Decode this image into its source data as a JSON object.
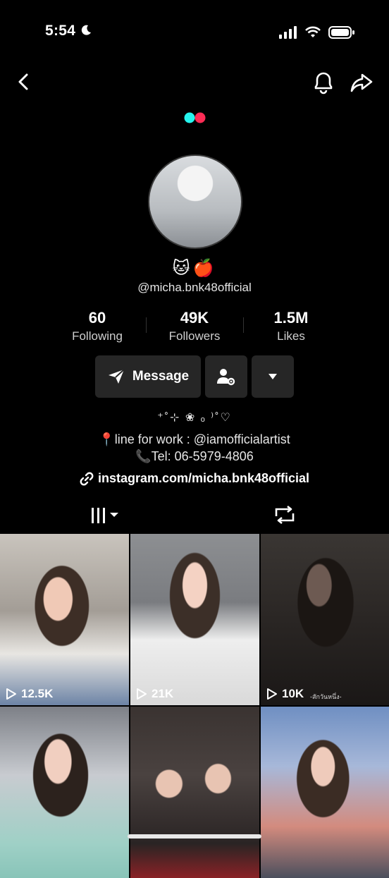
{
  "status_bar": {
    "time": "5:54",
    "moon_icon": "moon-icon",
    "signal_icon": "signal-icon",
    "wifi_icon": "wifi-icon",
    "battery_icon": "battery-icon"
  },
  "nav": {
    "back_icon": "chevron-left-icon",
    "bell_icon": "bell-icon",
    "share_icon": "share-icon"
  },
  "profile": {
    "emojis": "🐱🍎",
    "username": "@micha.bnk48official",
    "stats": [
      {
        "value": "60",
        "label": "Following"
      },
      {
        "value": "49K",
        "label": "Followers"
      },
      {
        "value": "1.5M",
        "label": "Likes"
      }
    ],
    "message_label": "Message",
    "bio_line1": "⁺˚⊹ ❀   ₒ ⁾˚♡",
    "bio_line2": "📍line for work : @iamofficialartist",
    "bio_line3": "📞Tel: 06-5979-4806",
    "link": "instagram.com/micha.bnk48official"
  },
  "colors": {
    "accent_cyan": "#25F4EE",
    "accent_red": "#FE2C55",
    "button_bg": "#262626"
  },
  "videos": [
    {
      "views": "12.5K"
    },
    {
      "views": "21K"
    },
    {
      "views": "10K",
      "caption": "-สักวันหนึ่ง-"
    },
    {
      "views": ""
    },
    {
      "views": ""
    },
    {
      "views": ""
    }
  ]
}
